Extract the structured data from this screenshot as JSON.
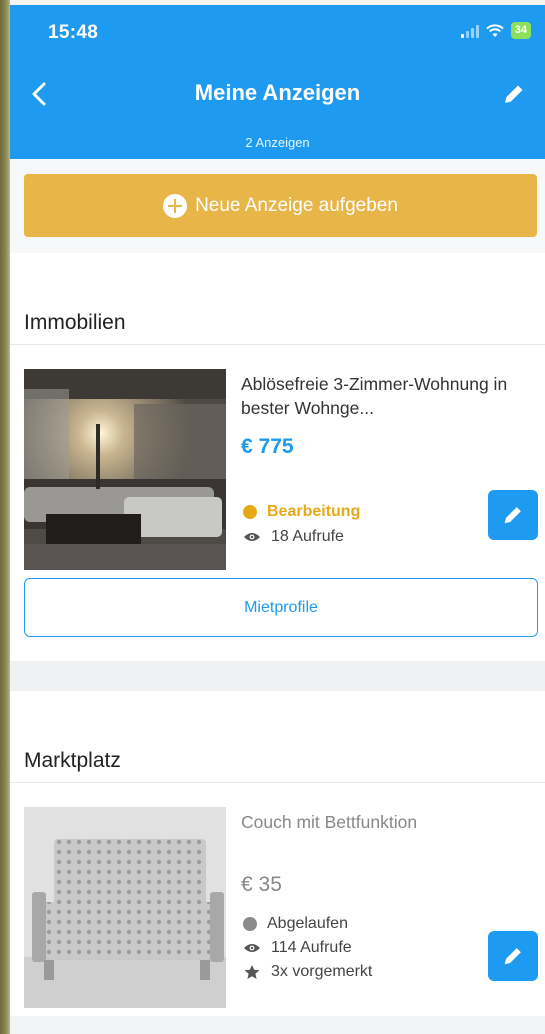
{
  "status_bar": {
    "time": "15:48",
    "battery": "34"
  },
  "header": {
    "title": "Meine Anzeigen",
    "subtitle": "2 Anzeigen"
  },
  "new_ad_button": {
    "label": "Neue Anzeige aufgeben"
  },
  "sections": [
    {
      "title": "Immobilien",
      "ad": {
        "title": "Ablösefreie 3-Zimmer-Wohnung in bester Wohnge...",
        "price": "€ 775",
        "status": "Bearbeitung",
        "views": "18 Aufrufe",
        "action_label": "Mietprofile"
      }
    },
    {
      "title": "Marktplatz",
      "ad": {
        "title": "Couch mit Bettfunktion",
        "price": "€ 35",
        "status": "Abgelaufen",
        "views": "114 Aufrufe",
        "saved": "3x vorgemerkt"
      }
    }
  ],
  "colors": {
    "primary": "#1e9bf0",
    "accent": "#e8b548",
    "status_editing": "#e8a818",
    "status_expired": "#8a8a8a"
  },
  "icons": [
    "back-arrow-icon",
    "pencil-icon",
    "plus-circle-icon",
    "eye-icon",
    "star-icon"
  ]
}
